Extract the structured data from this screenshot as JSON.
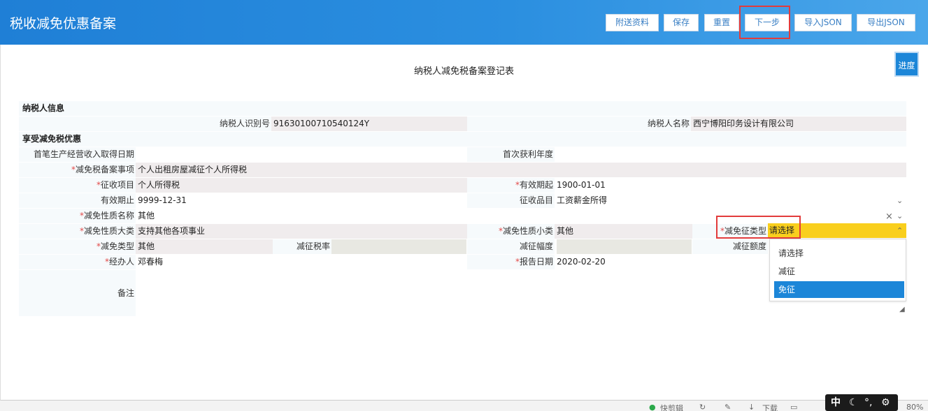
{
  "header": {
    "title": "税收减免优惠备案",
    "buttons": [
      "附送资料",
      "保存",
      "重置",
      "下一步",
      "导入JSON",
      "导出JSON"
    ]
  },
  "form": {
    "title": "纳税人减免税备案登记表",
    "progress_label": "进度",
    "sections": {
      "taxpayer": "纳税人信息",
      "benefit": "享受减免税优惠"
    },
    "fields": {
      "taxpayer_id_label": "纳税人识别号",
      "taxpayer_id": "91630100710540124Y",
      "taxpayer_name_label": "纳税人名称",
      "taxpayer_name": "西宁博阳印务设计有限公司",
      "first_income_date_label": "首笔生产经营收入取得日期",
      "first_profit_year_label": "首次获利年度",
      "filing_item_label": "减免税备案事项",
      "filing_item": "个人出租房屋减征个人所得税",
      "levy_item_label": "征收项目",
      "levy_item": "个人所得税",
      "valid_from_label": "有效期起",
      "valid_from": "1900-01-01",
      "valid_to_label": "有效期止",
      "valid_to": "9999-12-31",
      "levy_category_label": "征收品目",
      "levy_category": "工资薪金所得",
      "nature_name_label": "减免性质名称",
      "nature_name": "其他",
      "nature_major_label": "减免性质大类",
      "nature_major": "支持其他各项事业",
      "nature_minor_label": "减免性质小类",
      "nature_minor": "其他",
      "reduction_type_label": "减免征类型",
      "reduction_type": "请选择",
      "exempt_type_label": "减免类型",
      "exempt_type": "其他",
      "reduced_rate_label": "减征税率",
      "reduced_range_label": "减征幅度",
      "reduced_amount_label": "减征额度",
      "handler_label": "经办人",
      "handler": "邓春梅",
      "report_date_label": "报告日期",
      "report_date": "2020-02-20",
      "remark_label": "备注"
    },
    "dropdown_options": [
      "请选择",
      "减征",
      "免征"
    ],
    "dropdown_selected": "免征"
  },
  "statusbar": {
    "items": [
      "快剪辑",
      "下载",
      "80%"
    ],
    "ime": "中"
  },
  "colors": {
    "header_blue": "#1f7fd6",
    "highlight_red": "#e23b3b",
    "select_yellow": "#f9cf1d",
    "option_selected": "#1c86d8"
  }
}
